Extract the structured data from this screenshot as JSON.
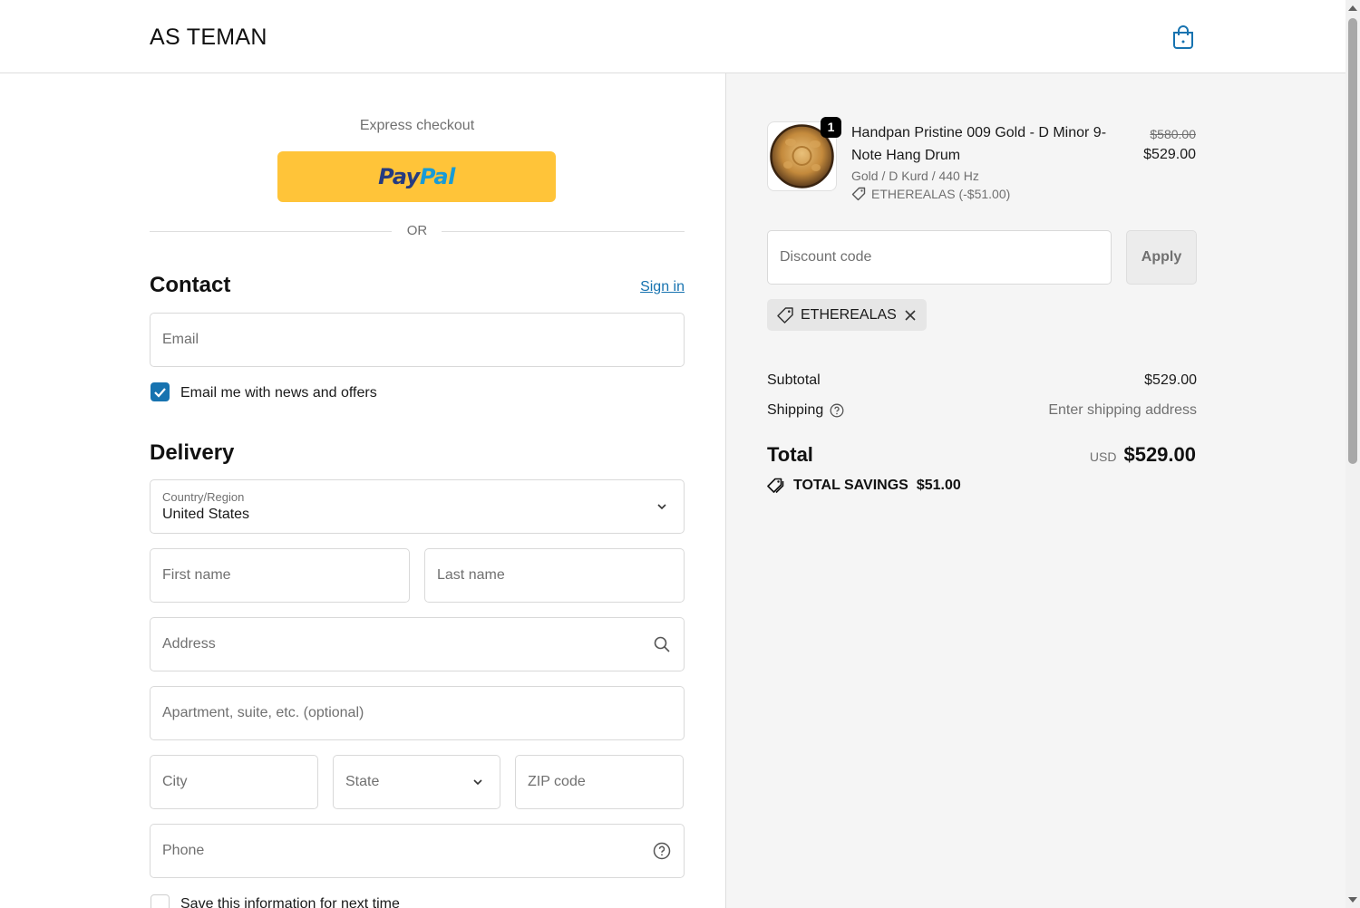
{
  "header": {
    "brand": "AS TEMAN",
    "cart_icon": "shopping-bag-icon"
  },
  "express": {
    "label": "Express checkout",
    "paypal_label_1": "Pay",
    "paypal_label_2": "Pal",
    "or": "OR"
  },
  "contact": {
    "title": "Contact",
    "sign_in": "Sign in",
    "email_placeholder": "Email",
    "newsletter_label": "Email me with news and offers",
    "newsletter_checked": true
  },
  "delivery": {
    "title": "Delivery",
    "country_label": "Country/Region",
    "country_value": "United States",
    "first_name_placeholder": "First name",
    "last_name_placeholder": "Last name",
    "address_placeholder": "Address",
    "apartment_placeholder": "Apartment, suite, etc. (optional)",
    "city_placeholder": "City",
    "state_placeholder": "State",
    "zip_placeholder": "ZIP code",
    "phone_placeholder": "Phone",
    "save_info_label": "Save this information for next time"
  },
  "order": {
    "quantity": "1",
    "product_name": "Handpan Pristine 009 Gold - D Minor 9-Note Hang Drum",
    "variant": "Gold / D Kurd / 440 Hz",
    "discount_line": "ETHEREALAS (-$51.00)",
    "price_original": "$580.00",
    "price_final": "$529.00",
    "discount_placeholder": "Discount code",
    "apply_label": "Apply",
    "applied_code": "ETHEREALAS",
    "subtotal_label": "Subtotal",
    "subtotal_value": "$529.00",
    "shipping_label": "Shipping",
    "shipping_value": "Enter shipping address",
    "total_label": "Total",
    "total_currency": "USD",
    "total_value": "$529.00",
    "savings_label": "TOTAL SAVINGS",
    "savings_value": "$51.00"
  },
  "colors": {
    "accent": "#1773b0",
    "paypal": "#ffc439",
    "summary_bg": "#f5f5f5"
  }
}
